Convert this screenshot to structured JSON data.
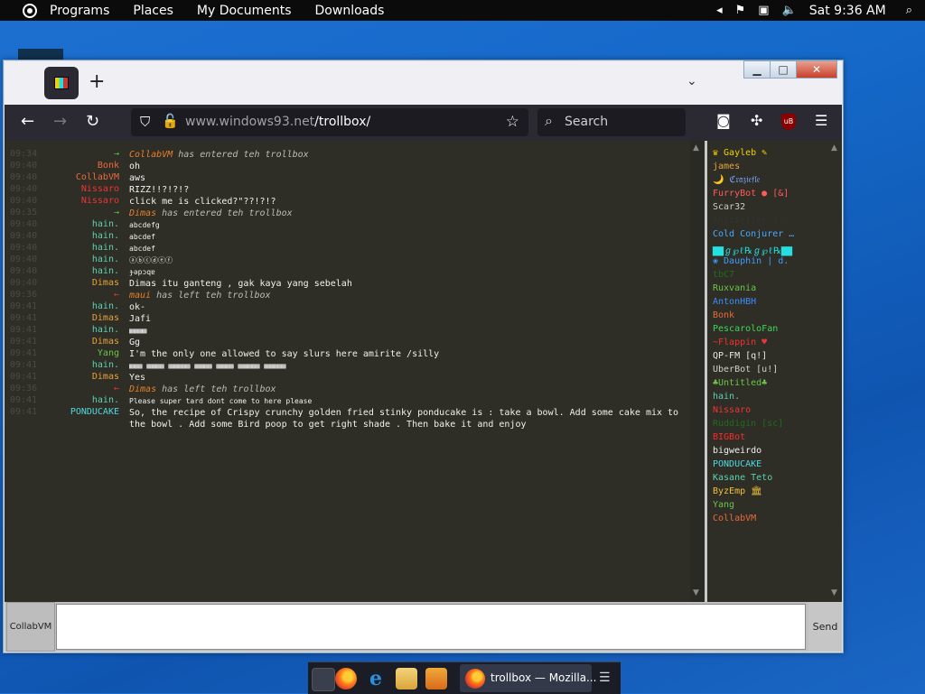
{
  "top_panel": {
    "menus": [
      "Programs",
      "Places",
      "My Documents",
      "Downloads"
    ],
    "clock": "Sat 9:36 AM"
  },
  "browser": {
    "url_host": "www.windows93.net",
    "url_path": "/trollbox/",
    "search_placeholder": "Search"
  },
  "chat": {
    "messages": [
      {
        "time": "09:34",
        "name": "→",
        "color": "#4ccb3f",
        "text": "",
        "sys": "has entered teh trollbox",
        "who": "CollabVM"
      },
      {
        "time": "09:40",
        "name": "Bonk",
        "color": "#e86a3c",
        "text": "oh"
      },
      {
        "time": "09:40",
        "name": "CollabVM",
        "color": "#e86a3c",
        "text": "aws"
      },
      {
        "time": "09:40",
        "name": "Nissaro",
        "color": "#e33",
        "text": "RIZZ!!?!?!?"
      },
      {
        "time": "09:40",
        "name": "Nissaro",
        "color": "#e33",
        "text": "click me is clicked?\"??!?!?"
      },
      {
        "time": "09:35",
        "name": "→",
        "color": "#4ccb3f",
        "text": "",
        "sys": "has entered teh trollbox",
        "who": "Dimas"
      },
      {
        "time": "09:40",
        "name": "hain.",
        "color": "#5ed0b0",
        "text": "abcdefg",
        "small": true
      },
      {
        "time": "09:40",
        "name": "hain.",
        "color": "#5ed0b0",
        "text": "abcdef",
        "small": true
      },
      {
        "time": "09:40",
        "name": "hain.",
        "color": "#5ed0b0",
        "text": "abcdef",
        "small": true
      },
      {
        "time": "09:40",
        "name": "hain.",
        "color": "#5ed0b0",
        "text": "ⓐⓑⓒⓓⓔⓕ",
        "small": true
      },
      {
        "time": "09:40",
        "name": "hain.",
        "color": "#5ed0b0",
        "text": "ɟǝpɔqɐ",
        "small": true
      },
      {
        "time": "09:40",
        "name": "Dimas",
        "color": "#e8a23c",
        "text": "Dimas itu ganteng , gak kaya yang sebelah"
      },
      {
        "time": "09:36",
        "name": "←",
        "color": "#e33",
        "text": "",
        "sys": "has left teh trollbox",
        "who": "maui"
      },
      {
        "time": "09:41",
        "name": "hain.",
        "color": "#5ed0b0",
        "text": "ok-"
      },
      {
        "time": "09:41",
        "name": "Dimas",
        "color": "#e8a23c",
        "text": "Jafi"
      },
      {
        "time": "09:41",
        "name": "hain.",
        "color": "#5ed0b0",
        "text": "▦▦▦▦",
        "small": true
      },
      {
        "time": "09:41",
        "name": "Dimas",
        "color": "#e8a23c",
        "text": "Gg"
      },
      {
        "time": "09:41",
        "name": "Yang",
        "color": "#6cc34c",
        "text": "I'm the only one allowed to say slurs here amirite /silly"
      },
      {
        "time": "09:41",
        "name": "hain.",
        "color": "#5ed0b0",
        "text": "▦▦▦ ▦▦▦▦ ▦▦▦▦▦ ▦▦▦▦ ▦▦▦▦ ▦▦▦▦▦ ▦▦▦▦▦",
        "small": true
      },
      {
        "time": "09:41",
        "name": "Dimas",
        "color": "#e8a23c",
        "text": "Yes"
      },
      {
        "time": "09:36",
        "name": "←",
        "color": "#e33",
        "text": "",
        "sys": "has left teh trollbox",
        "who": "Dimas"
      },
      {
        "time": "09:41",
        "name": "hain.",
        "color": "#5ed0b0",
        "text": "Please super tard dont come to here please",
        "small": true
      },
      {
        "time": "09:41",
        "name": "PONDUCAKE",
        "color": "#4fd8e0",
        "text": "So, the recipe of Crispy crunchy golden fried stinky ponducake is : take a bowl. Add some cake mix to\nthe bowl . Add some Bird poop to get right shade . Then bake it and enjoy"
      }
    ]
  },
  "users": [
    {
      "name": "♛ Gayleb ✎",
      "color": "#f0d000"
    },
    {
      "name": "james",
      "color": "#e8a23c"
    },
    {
      "name": "🌙 ℭ𝔯𝔞𝔷𝔦𝔢𝔣𝔩𝔢",
      "color": "#7fa8ff"
    },
    {
      "name": "FurryBot ● [&]",
      "color": "#ff5a5a"
    },
    {
      "name": "Scar32",
      "color": "#cccccc"
    },
    {
      "name": "Antisetter | ⚠",
      "color": "#333333"
    },
    {
      "name": "Cold Conjurer …",
      "color": "#4aa8ff"
    },
    {
      "name": "▇▇ℊ℘ℓ℞ℊ℘ℓ℞▇▇",
      "color": "#25e0e0"
    },
    {
      "name": "❀ Dauphin | d.",
      "color": "#3c9cff"
    },
    {
      "name": "tbC7",
      "color": "#1f6b1f"
    },
    {
      "name": "Ruxvania",
      "color": "#6cc34c"
    },
    {
      "name": "AntonHBH",
      "color": "#3c8cff"
    },
    {
      "name": "Bonk",
      "color": "#e86a3c"
    },
    {
      "name": "PescaroloFan",
      "color": "#3cd65a"
    },
    {
      "name": "~Flappin ♥",
      "color": "#e33"
    },
    {
      "name": "QP-FM [q!]",
      "color": "#e8e8e8"
    },
    {
      "name": "UberBot [u!]",
      "color": "#cfcfcf"
    },
    {
      "name": "♣Untitled♣",
      "color": "#6cc34c"
    },
    {
      "name": "hain.",
      "color": "#5ed0b0"
    },
    {
      "name": "Nissaro",
      "color": "#e33"
    },
    {
      "name": "Ruddigin [sc]",
      "color": "#1f6b1f"
    },
    {
      "name": "BIGBot",
      "color": "#ff2a2a"
    },
    {
      "name": "bigweirdo",
      "color": "#f0f0f0"
    },
    {
      "name": "PONDUCAKE",
      "color": "#4fd8e0"
    },
    {
      "name": "Kasane Teto",
      "color": "#5ed0b0"
    },
    {
      "name": "ByzEmp 🏛",
      "color": "#f0c03c"
    },
    {
      "name": "Yang",
      "color": "#6cc34c"
    },
    {
      "name": "CollabVM",
      "color": "#e86a3c"
    }
  ],
  "input": {
    "nick": "CollabVM",
    "send": "Send"
  },
  "taskbar": {
    "task_label": "trollbox — Mozilla..."
  }
}
